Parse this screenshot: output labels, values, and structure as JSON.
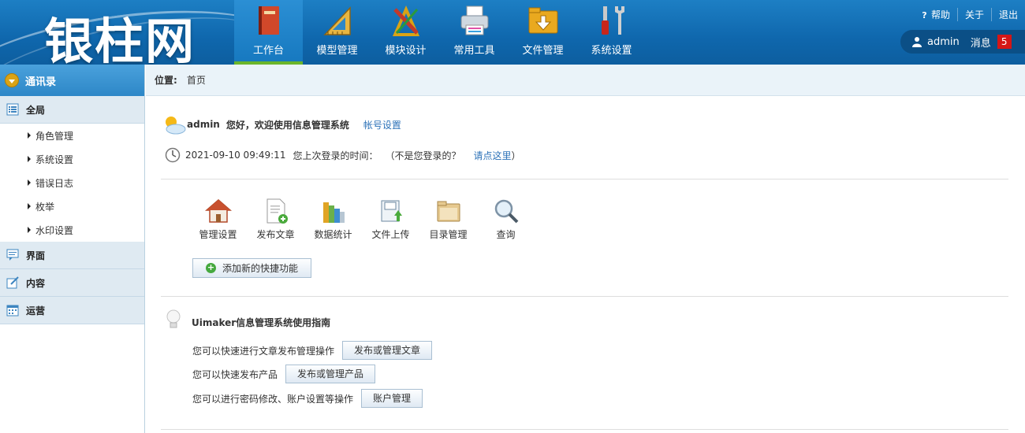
{
  "header": {
    "logo": "银柱网",
    "nav": [
      {
        "label": "工作台",
        "icon": "book-icon",
        "active": true
      },
      {
        "label": "模型管理",
        "icon": "ruler-icon",
        "active": false
      },
      {
        "label": "模块设计",
        "icon": "design-tools-icon",
        "active": false
      },
      {
        "label": "常用工具",
        "icon": "printer-icon",
        "active": false
      },
      {
        "label": "文件管理",
        "icon": "folder-download-icon",
        "active": false
      },
      {
        "label": "系统设置",
        "icon": "wrench-screwdriver-icon",
        "active": false
      }
    ],
    "links": {
      "help": "帮助",
      "about": "关于",
      "logout": "退出"
    },
    "user": {
      "name": "admin",
      "messages_label": "消息",
      "message_count": "5"
    }
  },
  "sidebar": {
    "title": "通讯录",
    "groups": [
      {
        "label": "全局",
        "icon": "list-icon",
        "items": [
          "角色管理",
          "系统设置",
          "错误日志",
          "枚举",
          "水印设置"
        ]
      },
      {
        "label": "界面",
        "icon": "chat-icon",
        "items": []
      },
      {
        "label": "内容",
        "icon": "edit-icon",
        "items": []
      },
      {
        "label": "运营",
        "icon": "calendar-icon",
        "items": []
      }
    ]
  },
  "breadcrumb": {
    "label": "位置:",
    "current": "首页"
  },
  "welcome": {
    "user": "admin",
    "text": "您好，欢迎使用信息管理系统",
    "account_link": "帐号设置",
    "last_login_time": "2021-09-10 09:49:11",
    "last_login_label": "您上次登录的时间：",
    "not_you": "（不是您登录的？",
    "click_here": "请点这里",
    "close_paren": "）"
  },
  "quick_actions": [
    {
      "label": "管理设置",
      "icon": "house-icon"
    },
    {
      "label": "发布文章",
      "icon": "new-document-icon"
    },
    {
      "label": "数据统计",
      "icon": "bar-books-icon"
    },
    {
      "label": "文件上传",
      "icon": "file-upload-icon"
    },
    {
      "label": "目录管理",
      "icon": "folder-icon"
    },
    {
      "label": "查询",
      "icon": "magnifier-icon"
    }
  ],
  "add_quick": "添加新的快捷功能",
  "guide": {
    "title": "Uimaker信息管理系统使用指南",
    "rows": [
      {
        "text": "您可以快速进行文章发布管理操作",
        "button": "发布或管理文章"
      },
      {
        "text": "您可以快速发布产品",
        "button": "发布或管理产品"
      },
      {
        "text": "您可以进行密码修改、账户设置等操作",
        "button": "账户管理"
      }
    ]
  },
  "colors": {
    "header_bg": "#0f67ad",
    "active_tab_underline": "#6ab52b",
    "link": "#2c72b8",
    "badge": "#d51616"
  }
}
